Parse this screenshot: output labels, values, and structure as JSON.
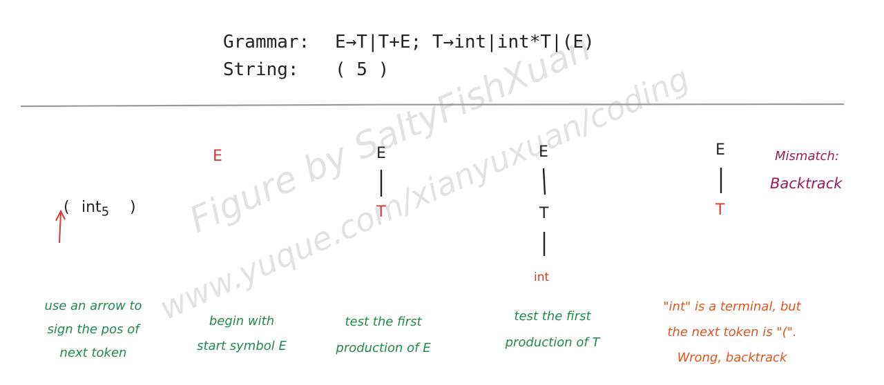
{
  "header": {
    "grammar_label": "Grammar:",
    "grammar_rules": "E→T|T+E; T→int|int*T|(E)",
    "string_label": "String:",
    "string_value": "( 5 )"
  },
  "input": {
    "open_paren": "(",
    "token": "int",
    "token_subscript": "5",
    "close_paren": ")"
  },
  "step2": {
    "root": "E"
  },
  "step3": {
    "root": "E",
    "child": "T"
  },
  "step4": {
    "root": "E",
    "child": "T",
    "grandchild": "int"
  },
  "step5": {
    "root": "E",
    "child": "T"
  },
  "mismatch": {
    "line1": "Mismatch:",
    "line2": "Backtrack"
  },
  "captions": {
    "c1": [
      "use an arrow to",
      "sign the pos of",
      "next token"
    ],
    "c2": [
      "begin with",
      "start symbol E"
    ],
    "c3": [
      "test the first",
      "production of E"
    ],
    "c4": [
      "test the first",
      "production of T"
    ],
    "c5": [
      "\"int\" is a terminal, but",
      "the next token is \"(\".",
      "Wrong, backtrack"
    ]
  },
  "watermark": {
    "line1": "Figure by SaltyFishXuan",
    "line2": "www.yuque.com/xianyuxuan/coding"
  },
  "colors": {
    "green": "#1f8a4c",
    "red": "#d63a2f",
    "purple": "#9b1b5a",
    "orange": "#e0531c"
  }
}
